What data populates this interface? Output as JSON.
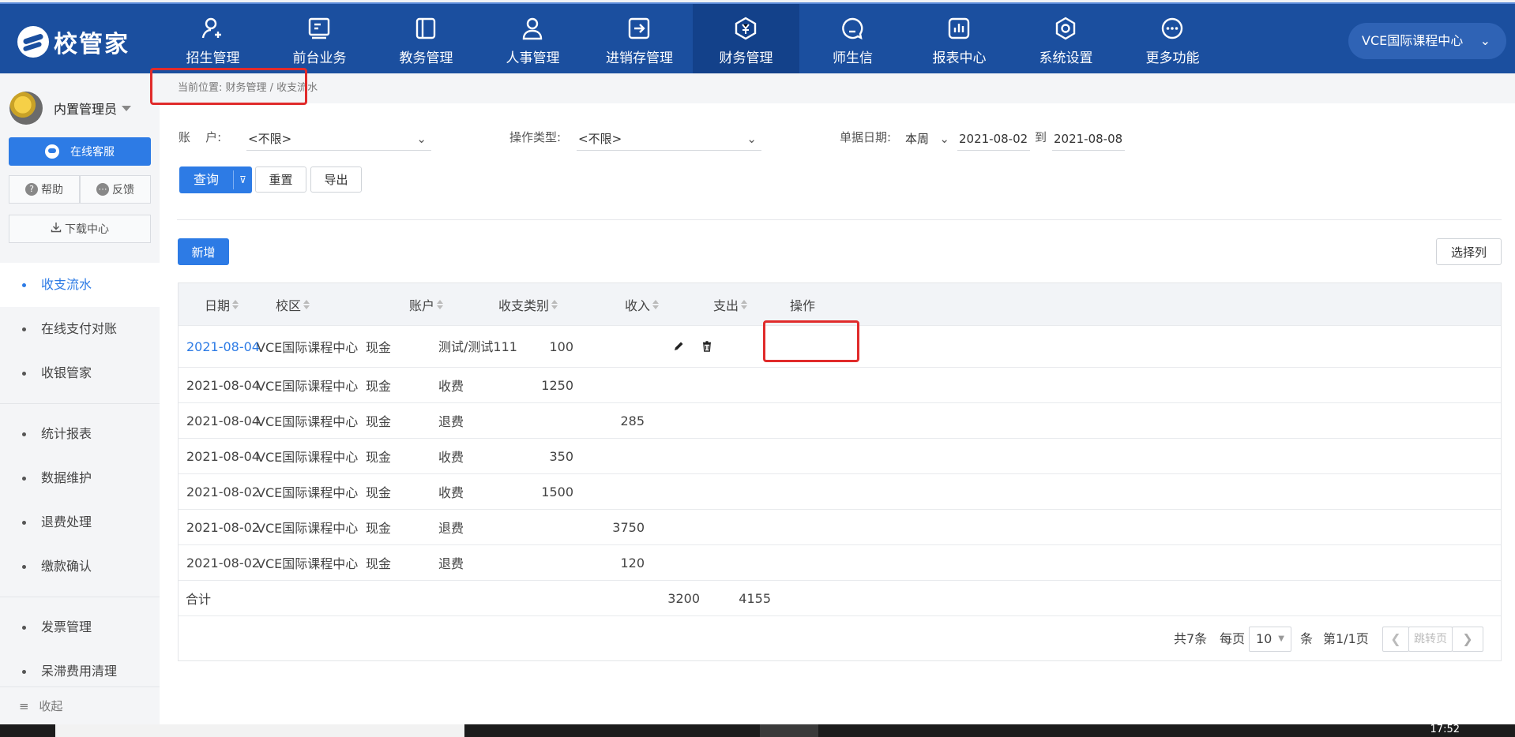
{
  "app": {
    "logo_text": "校管家"
  },
  "nav": [
    {
      "label": "招生管理",
      "icon": "user-add-icon"
    },
    {
      "label": "前台业务",
      "icon": "monitor-icon"
    },
    {
      "label": "教务管理",
      "icon": "book-icon"
    },
    {
      "label": "人事管理",
      "icon": "person-icon"
    },
    {
      "label": "进销存管理",
      "icon": "inventory-icon"
    },
    {
      "label": "财务管理",
      "icon": "finance-icon",
      "active": true
    },
    {
      "label": "师生信",
      "icon": "message-icon"
    },
    {
      "label": "报表中心",
      "icon": "report-icon"
    },
    {
      "label": "系统设置",
      "icon": "settings-icon"
    },
    {
      "label": "更多功能",
      "icon": "more-icon"
    }
  ],
  "school_select": "VCE国际课程中心",
  "sidebar": {
    "user_name": "内置管理员",
    "service_btn": "在线客服",
    "help": "帮助",
    "feedback": "反馈",
    "download": "下载中心",
    "collapse": "收起",
    "groups": [
      [
        "收支流水",
        "在线支付对账",
        "收银管家"
      ],
      [
        "统计报表",
        "数据维护",
        "退费处理",
        "缴款确认"
      ],
      [
        "发票管理",
        "呆滞费用清理"
      ]
    ]
  },
  "breadcrumb": "当前位置: 财务管理 / 收支流水",
  "filters": {
    "account_label": "账    户:",
    "account_value": "<不限>",
    "optype_label": "操作类型:",
    "optype_value": "<不限>",
    "date_label": "单据日期:",
    "date_range": "本周",
    "date_from": "2021-08-02",
    "date_to_sep": "到",
    "date_to": "2021-08-08"
  },
  "buttons": {
    "query": "查询",
    "reset": "重置",
    "export": "导出",
    "add": "新增",
    "columns": "选择列"
  },
  "table": {
    "headers": [
      "日期",
      "校区",
      "账户",
      "收支类别",
      "收入",
      "支出",
      "操作"
    ],
    "rows": [
      {
        "date": "2021-08-04",
        "campus": "VCE国际课程中心",
        "account": "现金",
        "category": "测试/测试111",
        "income": "100",
        "expense": "",
        "editable": true
      },
      {
        "date": "2021-08-04",
        "campus": "VCE国际课程中心",
        "account": "现金",
        "category": "收费",
        "income": "1250",
        "expense": ""
      },
      {
        "date": "2021-08-04",
        "campus": "VCE国际课程中心",
        "account": "现金",
        "category": "退费",
        "income": "",
        "expense": "285"
      },
      {
        "date": "2021-08-04",
        "campus": "VCE国际课程中心",
        "account": "现金",
        "category": "收费",
        "income": "350",
        "expense": ""
      },
      {
        "date": "2021-08-02",
        "campus": "VCE国际课程中心",
        "account": "现金",
        "category": "收费",
        "income": "1500",
        "expense": ""
      },
      {
        "date": "2021-08-02",
        "campus": "VCE国际课程中心",
        "account": "现金",
        "category": "退费",
        "income": "",
        "expense": "3750"
      },
      {
        "date": "2021-08-02",
        "campus": "VCE国际课程中心",
        "account": "现金",
        "category": "退费",
        "income": "",
        "expense": "120"
      }
    ],
    "total": {
      "label": "合计",
      "income": "3200",
      "expense": "4155"
    }
  },
  "pager": {
    "total": "共7条",
    "per_page_label": "每页",
    "per_page": "10",
    "unit": "条",
    "page_info": "第1/1页",
    "jump": "跳转页"
  },
  "taskbar": {
    "clock": "17:52"
  },
  "colors": {
    "primary": "#2d7be5",
    "nav_bg": "#1b4f9f",
    "highlight": "#e02b2b"
  }
}
